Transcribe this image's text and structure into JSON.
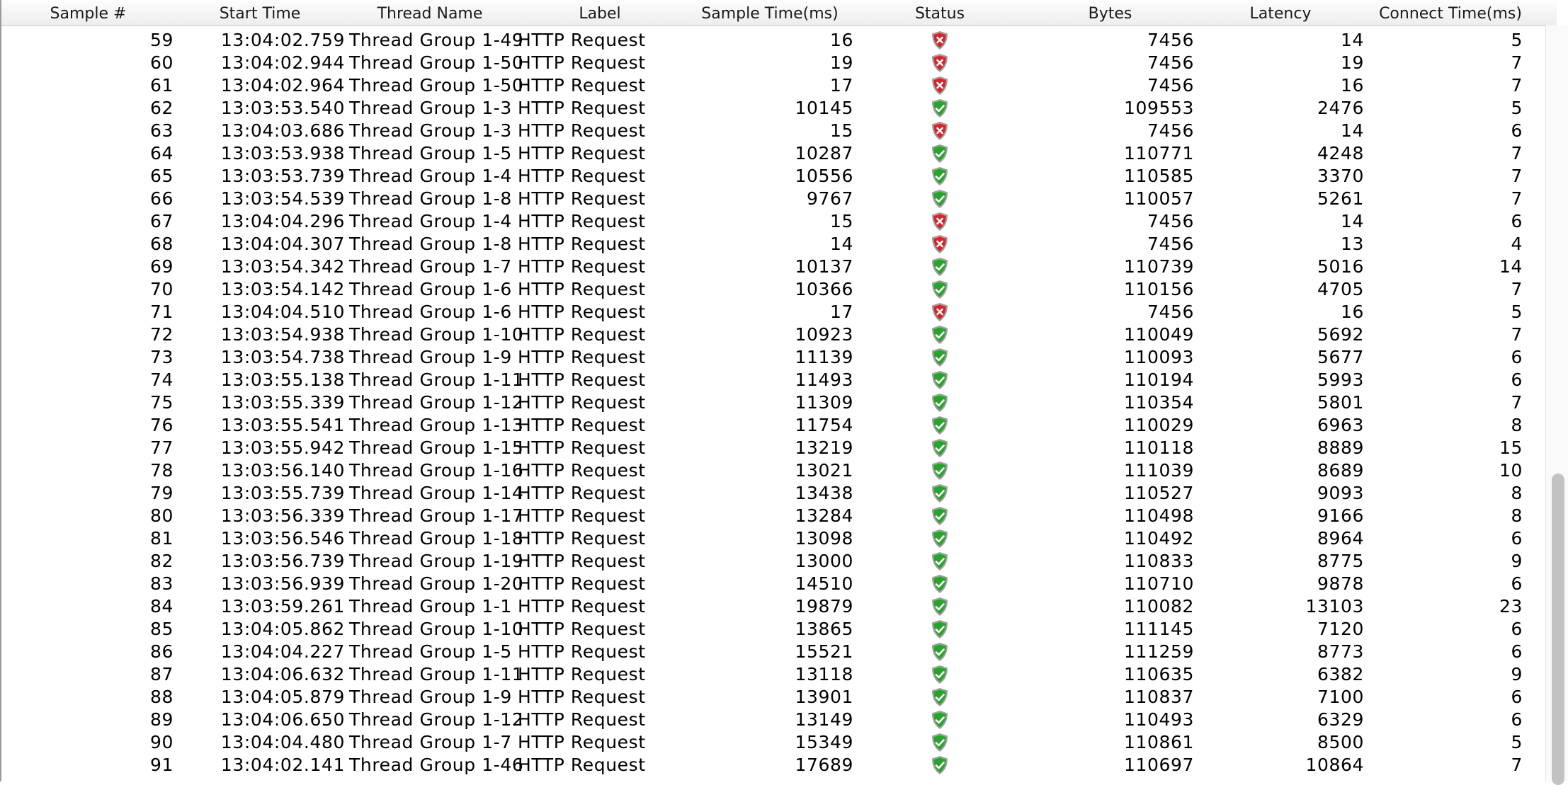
{
  "columns": [
    "Sample #",
    "Start Time",
    "Thread Name",
    "Label",
    "Sample Time(ms)",
    "Status",
    "Bytes",
    "Latency",
    "Connect Time(ms)"
  ],
  "status_icons": {
    "ok": "success-shield-icon",
    "fail": "error-shield-icon"
  },
  "colors": {
    "ok": "#27a52b",
    "fail": "#d8232a",
    "shield_rim": "#9e9e9e"
  },
  "rows": [
    {
      "sample": "59",
      "start": "13:04:02.759",
      "thread": "Thread Group 1-49",
      "label": "HTTP Request",
      "stime": "16",
      "status": "fail",
      "bytes": "7456",
      "latency": "14",
      "connect": "5"
    },
    {
      "sample": "60",
      "start": "13:04:02.944",
      "thread": "Thread Group 1-50",
      "label": "HTTP Request",
      "stime": "19",
      "status": "fail",
      "bytes": "7456",
      "latency": "19",
      "connect": "7"
    },
    {
      "sample": "61",
      "start": "13:04:02.964",
      "thread": "Thread Group 1-50",
      "label": "HTTP Request",
      "stime": "17",
      "status": "fail",
      "bytes": "7456",
      "latency": "16",
      "connect": "7"
    },
    {
      "sample": "62",
      "start": "13:03:53.540",
      "thread": "Thread Group 1-3",
      "label": "HTTP Request",
      "stime": "10145",
      "status": "ok",
      "bytes": "109553",
      "latency": "2476",
      "connect": "5"
    },
    {
      "sample": "63",
      "start": "13:04:03.686",
      "thread": "Thread Group 1-3",
      "label": "HTTP Request",
      "stime": "15",
      "status": "fail",
      "bytes": "7456",
      "latency": "14",
      "connect": "6"
    },
    {
      "sample": "64",
      "start": "13:03:53.938",
      "thread": "Thread Group 1-5",
      "label": "HTTP Request",
      "stime": "10287",
      "status": "ok",
      "bytes": "110771",
      "latency": "4248",
      "connect": "7"
    },
    {
      "sample": "65",
      "start": "13:03:53.739",
      "thread": "Thread Group 1-4",
      "label": "HTTP Request",
      "stime": "10556",
      "status": "ok",
      "bytes": "110585",
      "latency": "3370",
      "connect": "7"
    },
    {
      "sample": "66",
      "start": "13:03:54.539",
      "thread": "Thread Group 1-8",
      "label": "HTTP Request",
      "stime": "9767",
      "status": "ok",
      "bytes": "110057",
      "latency": "5261",
      "connect": "7"
    },
    {
      "sample": "67",
      "start": "13:04:04.296",
      "thread": "Thread Group 1-4",
      "label": "HTTP Request",
      "stime": "15",
      "status": "fail",
      "bytes": "7456",
      "latency": "14",
      "connect": "6"
    },
    {
      "sample": "68",
      "start": "13:04:04.307",
      "thread": "Thread Group 1-8",
      "label": "HTTP Request",
      "stime": "14",
      "status": "fail",
      "bytes": "7456",
      "latency": "13",
      "connect": "4"
    },
    {
      "sample": "69",
      "start": "13:03:54.342",
      "thread": "Thread Group 1-7",
      "label": "HTTP Request",
      "stime": "10137",
      "status": "ok",
      "bytes": "110739",
      "latency": "5016",
      "connect": "14"
    },
    {
      "sample": "70",
      "start": "13:03:54.142",
      "thread": "Thread Group 1-6",
      "label": "HTTP Request",
      "stime": "10366",
      "status": "ok",
      "bytes": "110156",
      "latency": "4705",
      "connect": "7"
    },
    {
      "sample": "71",
      "start": "13:04:04.510",
      "thread": "Thread Group 1-6",
      "label": "HTTP Request",
      "stime": "17",
      "status": "fail",
      "bytes": "7456",
      "latency": "16",
      "connect": "5"
    },
    {
      "sample": "72",
      "start": "13:03:54.938",
      "thread": "Thread Group 1-10",
      "label": "HTTP Request",
      "stime": "10923",
      "status": "ok",
      "bytes": "110049",
      "latency": "5692",
      "connect": "7"
    },
    {
      "sample": "73",
      "start": "13:03:54.738",
      "thread": "Thread Group 1-9",
      "label": "HTTP Request",
      "stime": "11139",
      "status": "ok",
      "bytes": "110093",
      "latency": "5677",
      "connect": "6"
    },
    {
      "sample": "74",
      "start": "13:03:55.138",
      "thread": "Thread Group 1-11",
      "label": "HTTP Request",
      "stime": "11493",
      "status": "ok",
      "bytes": "110194",
      "latency": "5993",
      "connect": "6"
    },
    {
      "sample": "75",
      "start": "13:03:55.339",
      "thread": "Thread Group 1-12",
      "label": "HTTP Request",
      "stime": "11309",
      "status": "ok",
      "bytes": "110354",
      "latency": "5801",
      "connect": "7"
    },
    {
      "sample": "76",
      "start": "13:03:55.541",
      "thread": "Thread Group 1-13",
      "label": "HTTP Request",
      "stime": "11754",
      "status": "ok",
      "bytes": "110029",
      "latency": "6963",
      "connect": "8"
    },
    {
      "sample": "77",
      "start": "13:03:55.942",
      "thread": "Thread Group 1-15",
      "label": "HTTP Request",
      "stime": "13219",
      "status": "ok",
      "bytes": "110118",
      "latency": "8889",
      "connect": "15"
    },
    {
      "sample": "78",
      "start": "13:03:56.140",
      "thread": "Thread Group 1-16",
      "label": "HTTP Request",
      "stime": "13021",
      "status": "ok",
      "bytes": "111039",
      "latency": "8689",
      "connect": "10"
    },
    {
      "sample": "79",
      "start": "13:03:55.739",
      "thread": "Thread Group 1-14",
      "label": "HTTP Request",
      "stime": "13438",
      "status": "ok",
      "bytes": "110527",
      "latency": "9093",
      "connect": "8"
    },
    {
      "sample": "80",
      "start": "13:03:56.339",
      "thread": "Thread Group 1-17",
      "label": "HTTP Request",
      "stime": "13284",
      "status": "ok",
      "bytes": "110498",
      "latency": "9166",
      "connect": "8"
    },
    {
      "sample": "81",
      "start": "13:03:56.546",
      "thread": "Thread Group 1-18",
      "label": "HTTP Request",
      "stime": "13098",
      "status": "ok",
      "bytes": "110492",
      "latency": "8964",
      "connect": "6"
    },
    {
      "sample": "82",
      "start": "13:03:56.739",
      "thread": "Thread Group 1-19",
      "label": "HTTP Request",
      "stime": "13000",
      "status": "ok",
      "bytes": "110833",
      "latency": "8775",
      "connect": "9"
    },
    {
      "sample": "83",
      "start": "13:03:56.939",
      "thread": "Thread Group 1-20",
      "label": "HTTP Request",
      "stime": "14510",
      "status": "ok",
      "bytes": "110710",
      "latency": "9878",
      "connect": "6"
    },
    {
      "sample": "84",
      "start": "13:03:59.261",
      "thread": "Thread Group 1-1",
      "label": "HTTP Request",
      "stime": "19879",
      "status": "ok",
      "bytes": "110082",
      "latency": "13103",
      "connect": "23"
    },
    {
      "sample": "85",
      "start": "13:04:05.862",
      "thread": "Thread Group 1-10",
      "label": "HTTP Request",
      "stime": "13865",
      "status": "ok",
      "bytes": "111145",
      "latency": "7120",
      "connect": "6"
    },
    {
      "sample": "86",
      "start": "13:04:04.227",
      "thread": "Thread Group 1-5",
      "label": "HTTP Request",
      "stime": "15521",
      "status": "ok",
      "bytes": "111259",
      "latency": "8773",
      "connect": "6"
    },
    {
      "sample": "87",
      "start": "13:04:06.632",
      "thread": "Thread Group 1-11",
      "label": "HTTP Request",
      "stime": "13118",
      "status": "ok",
      "bytes": "110635",
      "latency": "6382",
      "connect": "9"
    },
    {
      "sample": "88",
      "start": "13:04:05.879",
      "thread": "Thread Group 1-9",
      "label": "HTTP Request",
      "stime": "13901",
      "status": "ok",
      "bytes": "110837",
      "latency": "7100",
      "connect": "6"
    },
    {
      "sample": "89",
      "start": "13:04:06.650",
      "thread": "Thread Group 1-12",
      "label": "HTTP Request",
      "stime": "13149",
      "status": "ok",
      "bytes": "110493",
      "latency": "6329",
      "connect": "6"
    },
    {
      "sample": "90",
      "start": "13:04:04.480",
      "thread": "Thread Group 1-7",
      "label": "HTTP Request",
      "stime": "15349",
      "status": "ok",
      "bytes": "110861",
      "latency": "8500",
      "connect": "5"
    },
    {
      "sample": "91",
      "start": "13:04:02.141",
      "thread": "Thread Group 1-46",
      "label": "HTTP Request",
      "stime": "17689",
      "status": "ok",
      "bytes": "110697",
      "latency": "10864",
      "connect": "7"
    }
  ]
}
